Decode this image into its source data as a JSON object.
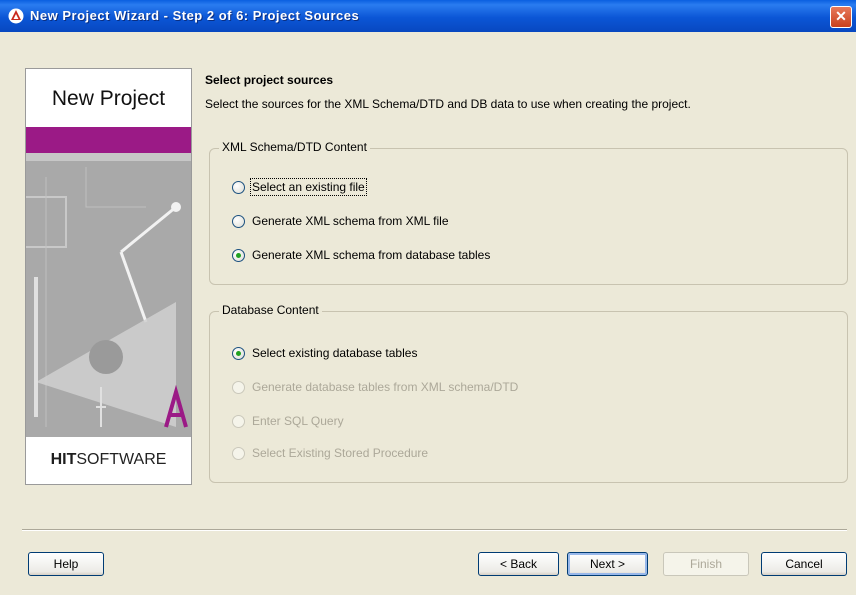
{
  "titlebar": {
    "title": "New Project Wizard - Step 2 of 6: Project Sources",
    "close_label": "✕"
  },
  "sidebar": {
    "title": "New Project",
    "brand_bold": "HIT",
    "brand_rest": "SOFTWARE"
  },
  "main": {
    "heading": "Select project sources",
    "description": "Select the sources for the XML Schema/DTD and DB data to use when creating the project."
  },
  "xml_group": {
    "legend": "XML Schema/DTD Content",
    "options": [
      {
        "label": "Select an existing file",
        "checked": false,
        "enabled": true
      },
      {
        "label": "Generate XML schema from XML file",
        "checked": false,
        "enabled": true
      },
      {
        "label": "Generate XML schema from database tables",
        "checked": true,
        "enabled": true
      }
    ]
  },
  "db_group": {
    "legend": "Database Content",
    "options": [
      {
        "label": "Select existing database tables",
        "checked": true,
        "enabled": true
      },
      {
        "label": "Generate database tables from XML schema/DTD",
        "checked": false,
        "enabled": false
      },
      {
        "label": "Enter SQL Query",
        "checked": false,
        "enabled": false
      },
      {
        "label": "Select Existing Stored Procedure",
        "checked": false,
        "enabled": false
      }
    ]
  },
  "buttons": {
    "help": "Help",
    "back": "< Back",
    "next": "Next >",
    "finish": "Finish",
    "cancel": "Cancel"
  },
  "colors": {
    "titlebar": "#0b56d6",
    "sidebar_band": "#9b1a86",
    "window_bg": "#ece9d8",
    "radio_checked": "#21a121"
  }
}
